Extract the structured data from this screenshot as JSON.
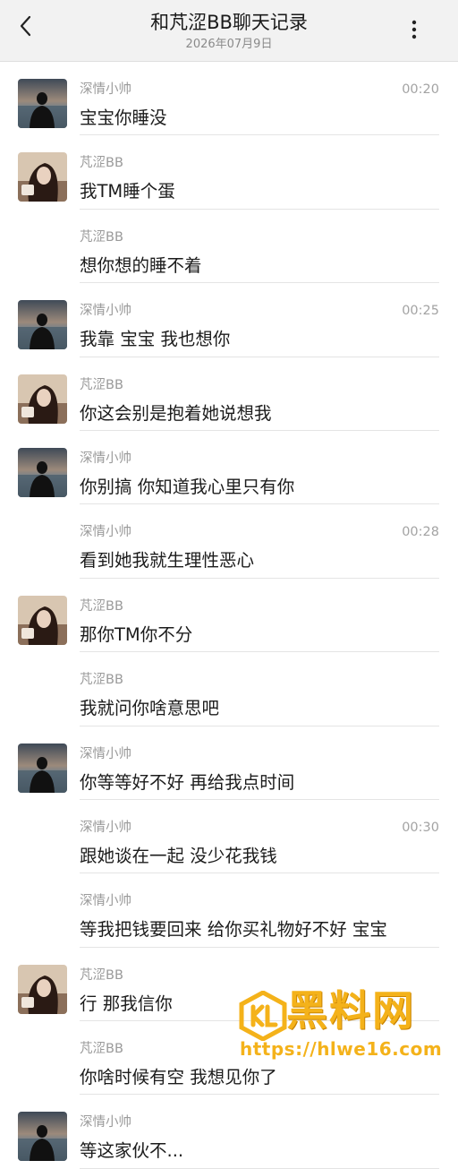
{
  "header": {
    "title": "和芃涩BB聊天记录",
    "date": "2026年07月9日"
  },
  "messages": [
    {
      "sender": "深情小帅",
      "time": "00:20",
      "text": "宝宝你睡没",
      "avatar": "male"
    },
    {
      "sender": "芃涩BB",
      "time": "",
      "text": "我TM睡个蛋",
      "avatar": "female"
    },
    {
      "sender": "芃涩BB",
      "time": "",
      "text": "想你想的睡不着",
      "avatar": ""
    },
    {
      "sender": "深情小帅",
      "time": "00:25",
      "text": "我靠 宝宝 我也想你",
      "avatar": "male"
    },
    {
      "sender": "芃涩BB",
      "time": "",
      "text": "你这会别是抱着她说想我",
      "avatar": "female"
    },
    {
      "sender": "深情小帅",
      "time": "",
      "text": "你别搞 你知道我心里只有你",
      "avatar": "male"
    },
    {
      "sender": "深情小帅",
      "time": "00:28",
      "text": "看到她我就生理性恶心",
      "avatar": ""
    },
    {
      "sender": "芃涩BB",
      "time": "",
      "text": "那你TM你不分",
      "avatar": "female"
    },
    {
      "sender": "芃涩BB",
      "time": "",
      "text": "我就问你啥意思吧",
      "avatar": ""
    },
    {
      "sender": "深情小帅",
      "time": "",
      "text": "你等等好不好 再给我点时间",
      "avatar": "male"
    },
    {
      "sender": "深情小帅",
      "time": "00:30",
      "text": "跟她谈在一起 没少花我钱",
      "avatar": ""
    },
    {
      "sender": "深情小帅",
      "time": "",
      "text": "等我把钱要回来 给你买礼物好不好 宝宝",
      "avatar": ""
    },
    {
      "sender": "芃涩BB",
      "time": "",
      "text": "行 那我信你",
      "avatar": "female"
    },
    {
      "sender": "芃涩BB",
      "time": "",
      "text": "你啥时候有空 我想见你了",
      "avatar": ""
    },
    {
      "sender": "深情小帅",
      "time": "",
      "text": "等这家伙不...",
      "avatar": "male"
    }
  ],
  "watermark": {
    "title": "黑料网",
    "url": "https://hlwe16.com"
  },
  "icons": {
    "back": "chevron-left-icon",
    "more": "more-vertical-icon"
  },
  "colors": {
    "header_bg": "#f2f2f2",
    "watermark": "#f4b21a"
  }
}
